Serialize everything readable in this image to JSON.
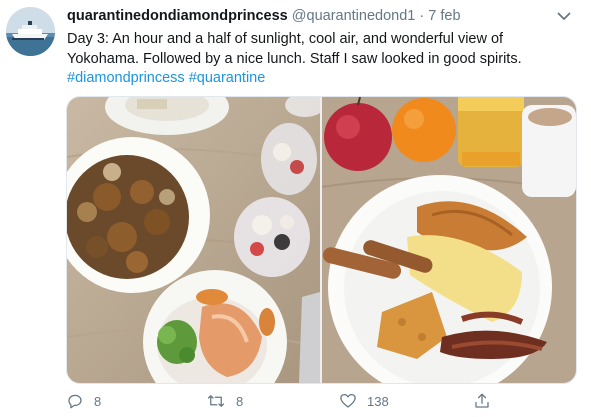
{
  "tweet": {
    "display_name": "quarantinedondiamondprincess",
    "handle": "@quarantinedond1",
    "separator": "·",
    "date": "7 feb",
    "text": "Day 3: An hour and a half of sunlight, cool air, and wonderful view of Yokohama. Followed by a nice lunch. Staff I saw looked in good spirits.",
    "hashtags": [
      "#diamondprincess",
      "#quarantine"
    ]
  },
  "media": {
    "photos": [
      {
        "description_icon": "food-photo-bowls"
      },
      {
        "description_icon": "food-photo-breakfast"
      }
    ]
  },
  "actions": {
    "reply_count": "8",
    "retweet_count": "8",
    "like_count": "138"
  },
  "colors": {
    "link": "#1b95e0",
    "secondary_text": "#657786",
    "primary_text": "#14171a"
  }
}
